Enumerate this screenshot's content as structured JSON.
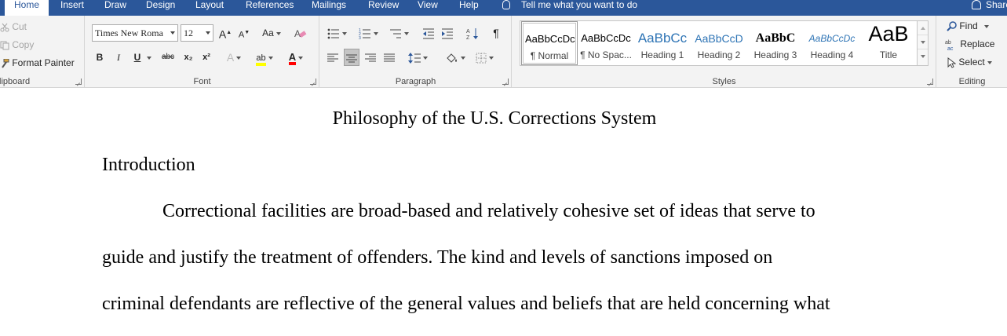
{
  "tabs": [
    "Home",
    "Insert",
    "Draw",
    "Design",
    "Layout",
    "References",
    "Mailings",
    "Review",
    "View",
    "Help"
  ],
  "tell_me": "Tell me what you want to do",
  "share": "Share",
  "clipboard": {
    "cut": "Cut",
    "copy": "Copy",
    "format_painter": "Format Painter",
    "label": "lipboard"
  },
  "font": {
    "name": "Times New Roma",
    "size": "12",
    "label": "Font",
    "bold": "B",
    "italic": "I",
    "underline": "U",
    "strike": "abc",
    "subscript": "x₂",
    "superscript": "x²",
    "grow": "A",
    "shrink": "A",
    "change_case": "Aa",
    "font_color_letter": "A",
    "text_effects": "A",
    "highlight": "ab",
    "colors": {
      "highlight": "#ffff00",
      "font_color": "#ff0000"
    }
  },
  "paragraph": {
    "label": "Paragraph",
    "show_marks": "¶"
  },
  "styles": {
    "label": "Styles",
    "items": [
      {
        "preview": "AaBbCcDc",
        "name": "¶ Normal"
      },
      {
        "preview": "AaBbCcDc",
        "name": "¶ No Spac..."
      },
      {
        "preview": "AaBbCc",
        "name": "Heading 1"
      },
      {
        "preview": "AaBbCcD",
        "name": "Heading 2"
      },
      {
        "preview": "AaBbC",
        "name": "Heading 3"
      },
      {
        "preview": "AaBbCcDc",
        "name": "Heading 4"
      },
      {
        "preview": "AaB",
        "name": "Title"
      }
    ]
  },
  "editing": {
    "find": "Find",
    "replace": "Replace",
    "select": "Select",
    "label": "Editing"
  },
  "document": {
    "title": "Philosophy of the U.S. Corrections System",
    "heading": "Introduction",
    "lines": [
      "Correctional facilities are broad-based and relatively cohesive set of ideas that serve to",
      "guide and justify the treatment of offenders. The kind and levels of sanctions imposed on",
      "criminal defendants are reflective of the general values and beliefs that are held concerning what"
    ]
  },
  "colors": {
    "ribbon_blue": "#2b579a",
    "ribbon_bg": "#f3f3f3",
    "heading_blue": "#2e74b5"
  }
}
